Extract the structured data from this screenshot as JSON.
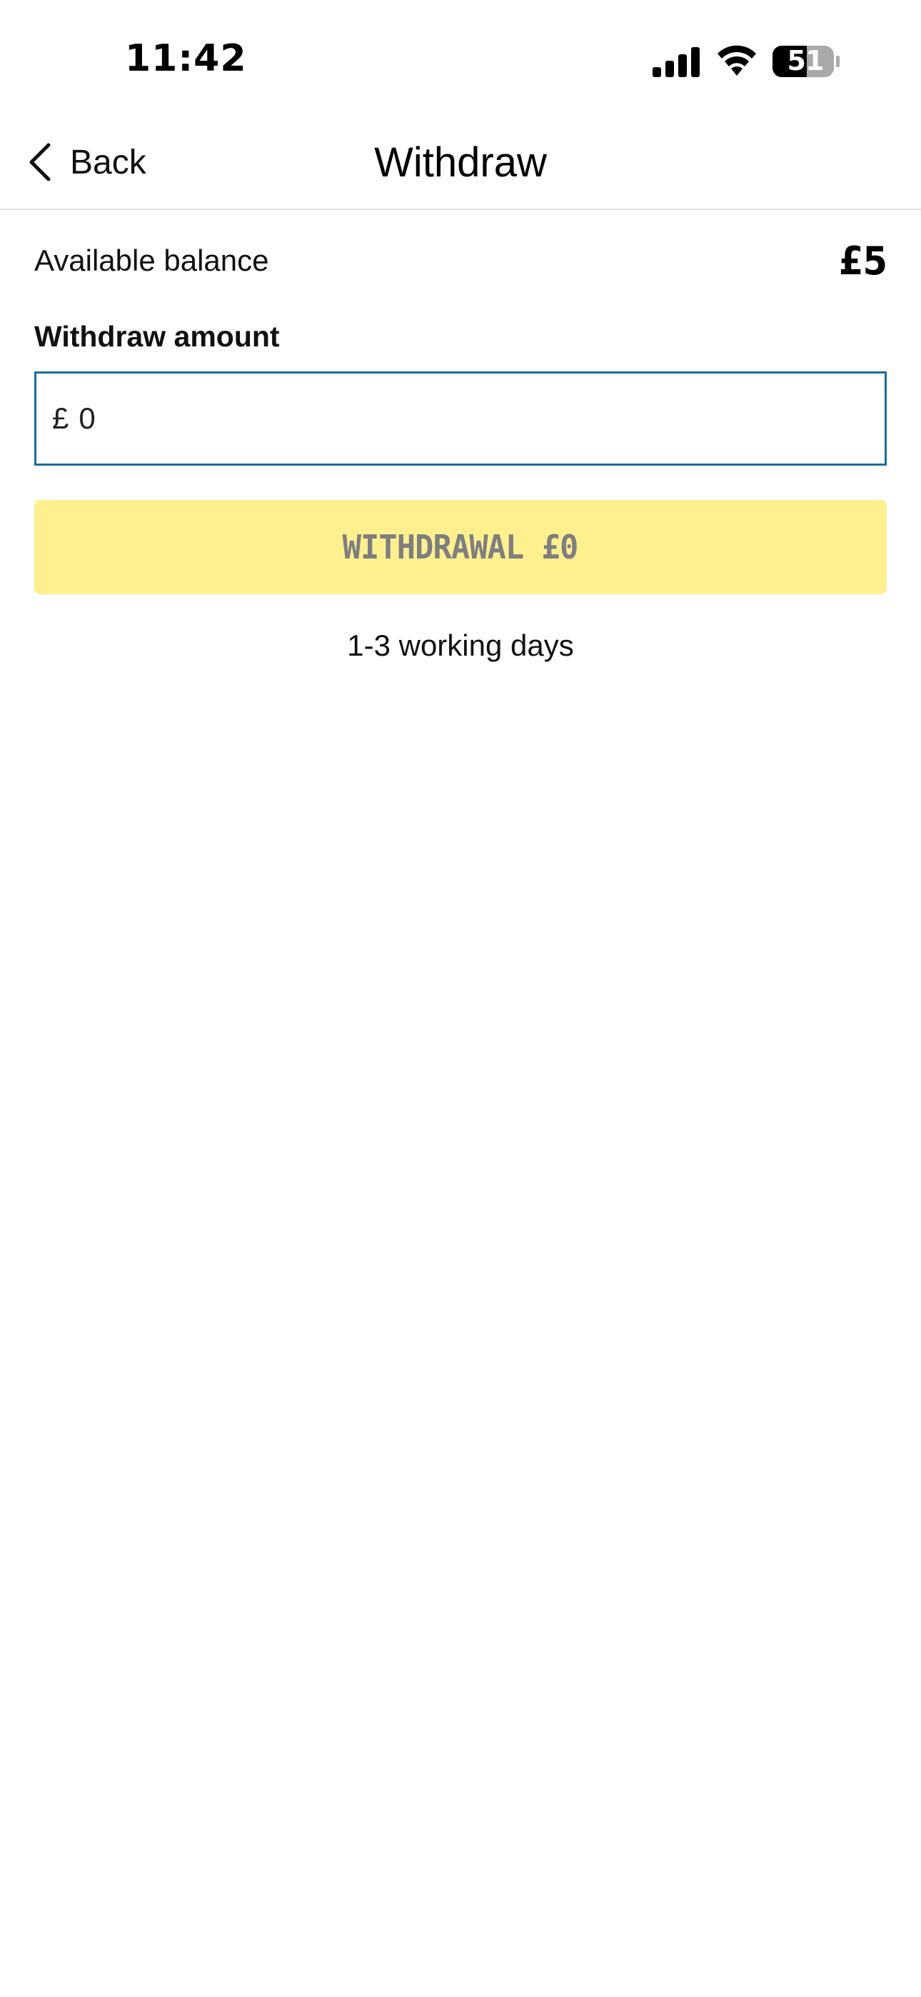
{
  "status_bar": {
    "time": "11:42",
    "battery_level": "51",
    "icons": [
      "signal-icon",
      "wifi-icon",
      "battery-icon"
    ]
  },
  "nav": {
    "back_label": "Back",
    "title": "Withdraw"
  },
  "balance": {
    "label": "Available balance",
    "value": "£5"
  },
  "amount": {
    "label": "Withdraw amount",
    "currency_symbol": "£",
    "value": "0"
  },
  "withdraw_button": {
    "label": "WITHDRAWAL £0",
    "background_color": "#fff08f",
    "text_color": "#7f7f7f"
  },
  "note": "1-3 working days",
  "colors": {
    "field_border": "#1b6e99"
  }
}
